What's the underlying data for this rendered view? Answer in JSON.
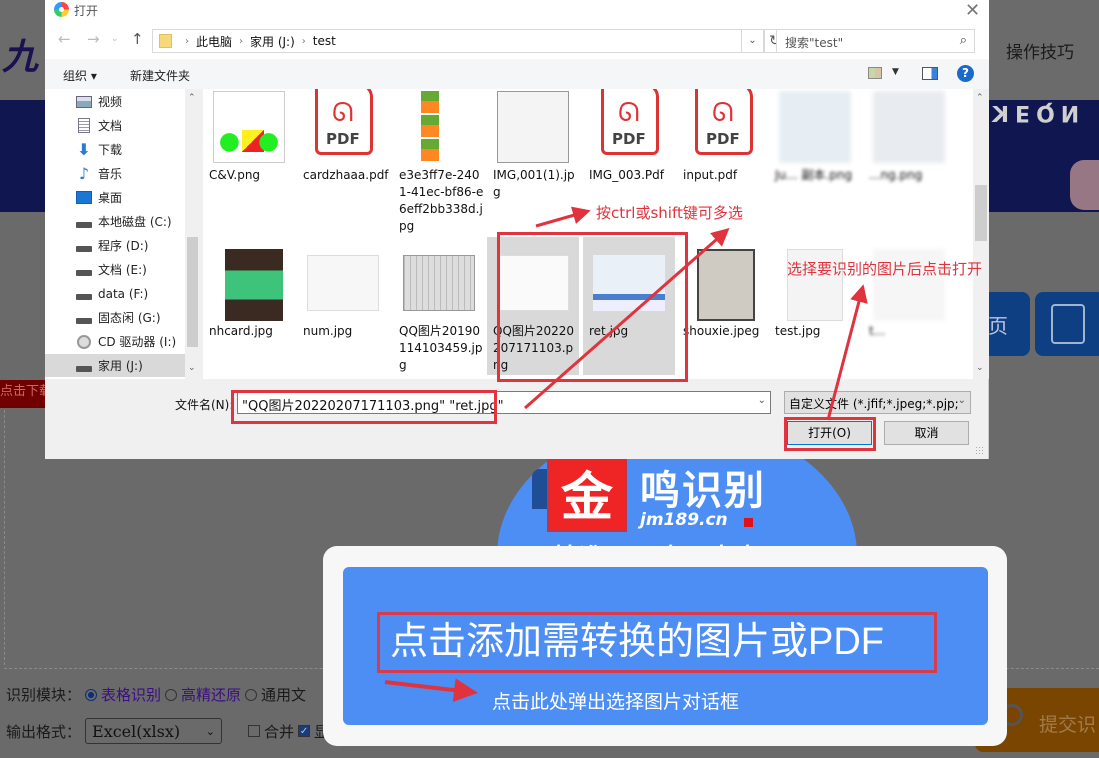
{
  "background_page": {
    "logo_text": "九",
    "header_link": "操作技巧",
    "banner_text": "ꓘEQN",
    "download_badge": "点击下载",
    "tile_partial_label": "页",
    "recognition_module": {
      "label": "识别模块：",
      "options": [
        "表格识别",
        "高精还原",
        "通用文"
      ],
      "selected": "表格识别"
    },
    "output_format": {
      "label": "输出格式：",
      "selected": "Excel(xlsx)",
      "merge_label": "合并",
      "merge_checked": false,
      "show_label": "显",
      "show_checked": true
    },
    "submit_label": "提交识"
  },
  "brand": {
    "logo_char": "金",
    "name": "鸣识别",
    "url": "jm189.cn",
    "slogan": "精准，不止一点点！"
  },
  "upload": {
    "main_label": "点击添加需转换的图片或PDF",
    "sub_label": "点击此处弹出选择图片对话框"
  },
  "dialog": {
    "title": "打开",
    "breadcrumb": [
      "此电脑",
      "家用 (J:)",
      "test"
    ],
    "search_placeholder": "搜索\"test\"",
    "toolbar": {
      "organize": "组织 ▾",
      "new_folder": "新建文件夹"
    },
    "sidebar": [
      {
        "label": "视频",
        "icon": "video-icon"
      },
      {
        "label": "文档",
        "icon": "document-icon"
      },
      {
        "label": "下载",
        "icon": "download-icon"
      },
      {
        "label": "音乐",
        "icon": "music-icon"
      },
      {
        "label": "桌面",
        "icon": "desktop-icon"
      },
      {
        "label": "本地磁盘 (C:)",
        "icon": "drive-icon"
      },
      {
        "label": "程序 (D:)",
        "icon": "drive-icon"
      },
      {
        "label": "文档 (E:)",
        "icon": "drive-icon"
      },
      {
        "label": "data (F:)",
        "icon": "drive-icon"
      },
      {
        "label": "固态闲 (G:)",
        "icon": "drive-icon"
      },
      {
        "label": "CD 驱动器 (I:)",
        "icon": "cd-drive-icon"
      },
      {
        "label": "家用 (J:)",
        "icon": "drive-icon",
        "selected": true
      }
    ],
    "files_row1": [
      {
        "name": "C&V.png",
        "type": "image"
      },
      {
        "name": "cardzhaaa.pdf",
        "type": "pdf"
      },
      {
        "name": "e3e3ff7e-2401-41ec-bf86-e6eff2bb338d.jpg",
        "type": "image"
      },
      {
        "name": "IMG,001(1).jpg",
        "type": "image"
      },
      {
        "name": "IMG_003.Pdf",
        "type": "pdf"
      },
      {
        "name": "input.pdf",
        "type": "pdf"
      },
      {
        "name": "Ju... 副本.png",
        "type": "image",
        "blurred": true
      },
      {
        "name": "...ng.png",
        "type": "image",
        "blurred": true
      }
    ],
    "files_row2": [
      {
        "name": "nhcard.jpg",
        "type": "image"
      },
      {
        "name": "num.jpg",
        "type": "image"
      },
      {
        "name": "QQ图片20190114103459.jpg",
        "type": "image"
      },
      {
        "name": "QQ图片20220207171103.png",
        "type": "image",
        "selected": true
      },
      {
        "name": "ret.jpg",
        "type": "image",
        "selected": true
      },
      {
        "name": "shouxie.jpeg",
        "type": "image"
      },
      {
        "name": "test.jpg",
        "type": "image"
      },
      {
        "name": "t...",
        "type": "image",
        "blurred": true
      }
    ],
    "filename_label": "文件名(N):",
    "filename_value": "\"QQ图片20220207171103.png\" \"ret.jpg\"",
    "filetype_value": "自定义文件 (*.jfif;*.jpeg;*.pjp;*",
    "open_button": "打开(O)",
    "cancel_button": "取消"
  },
  "annotations": {
    "multi_select_hint": "按ctrl或shift键可多选",
    "open_hint": "选择要识别的图片后点击打开",
    "color": "#e0333d"
  }
}
